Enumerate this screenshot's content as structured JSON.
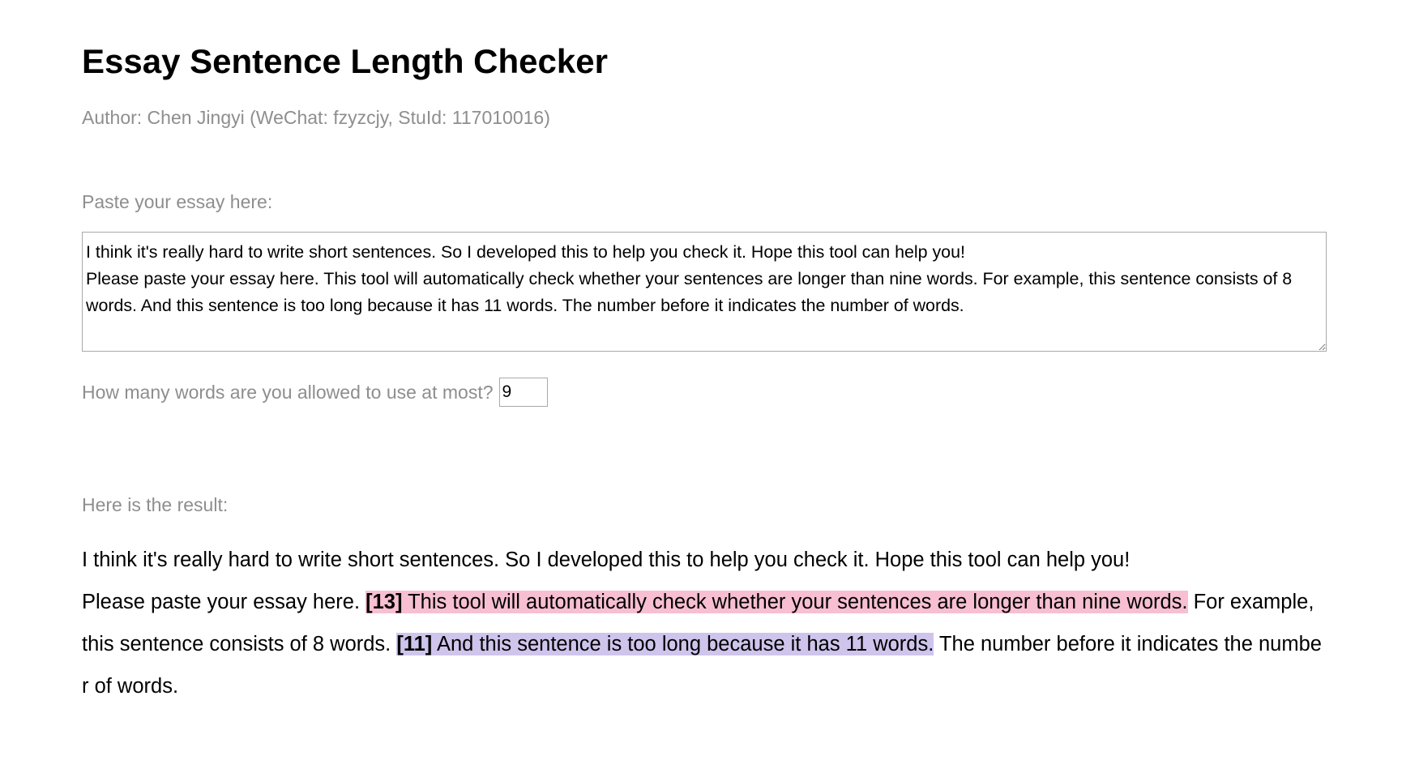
{
  "page": {
    "title": "Essay Sentence Length Checker",
    "author": "Author: Chen Jingyi (WeChat: fzyzcjy, StuId: 117010016)"
  },
  "essay": {
    "label": "Paste your essay here:",
    "value": "I think it's really hard to write short sentences. So I developed this to help you check it. Hope this tool can help you!\nPlease paste your essay here. This tool will automatically check whether your sentences are longer than nine words. For example, this sentence consists of 8 words. And this sentence is too long because it has 11 words. The number before it indicates the number of words."
  },
  "limit": {
    "label": "How many words are you allowed to use at most?",
    "value": "9"
  },
  "result": {
    "label": "Here is the result:",
    "line1": "I think it's really hard to write short sentences. So I developed this to help you check it. Hope this tool can help you!",
    "paragraph2": {
      "before_first": "Please paste your essay here. ",
      "first_count": "[13]",
      "first_sentence": " This tool will automatically check whether your sentences are longer than nine words.",
      "between": " For example, this sentence consists of 8 words. ",
      "second_count": "[11]",
      "second_sentence": " And this sentence is too long because it has 11 words.",
      "after_second": " The number before it indicates the number of words."
    }
  },
  "colors": {
    "text": "#000000",
    "muted_label": "#8e8e8e",
    "highlight_13": "#f7bfd1",
    "highlight_11": "#cfc4ec",
    "border": "#a9a9a9"
  }
}
